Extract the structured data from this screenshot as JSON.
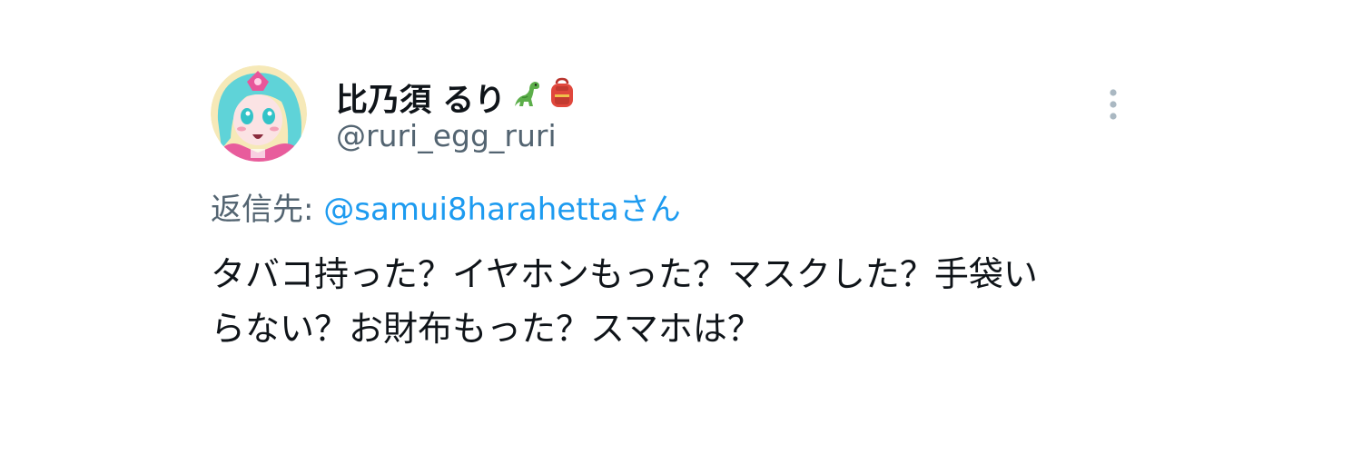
{
  "author": {
    "display_name": "比乃須 るり",
    "name_emojis": [
      "dinosaur-emoji",
      "backpack-emoji"
    ],
    "handle": "@ruri_egg_ruri"
  },
  "reply": {
    "prefix": "返信先: ",
    "target": "@samui8harahettaさん"
  },
  "tweet": {
    "lines": [
      "タバコ持った？イヤホンもった？マスクした？手袋い",
      "らない？お財布もった？スマホは？"
    ]
  },
  "menu": {
    "icon": "more-vertical-icon"
  },
  "colors": {
    "text_primary": "#0f1419",
    "text_secondary": "#536471",
    "link": "#1d9bf0",
    "menu_dots": "#aab8c2"
  }
}
